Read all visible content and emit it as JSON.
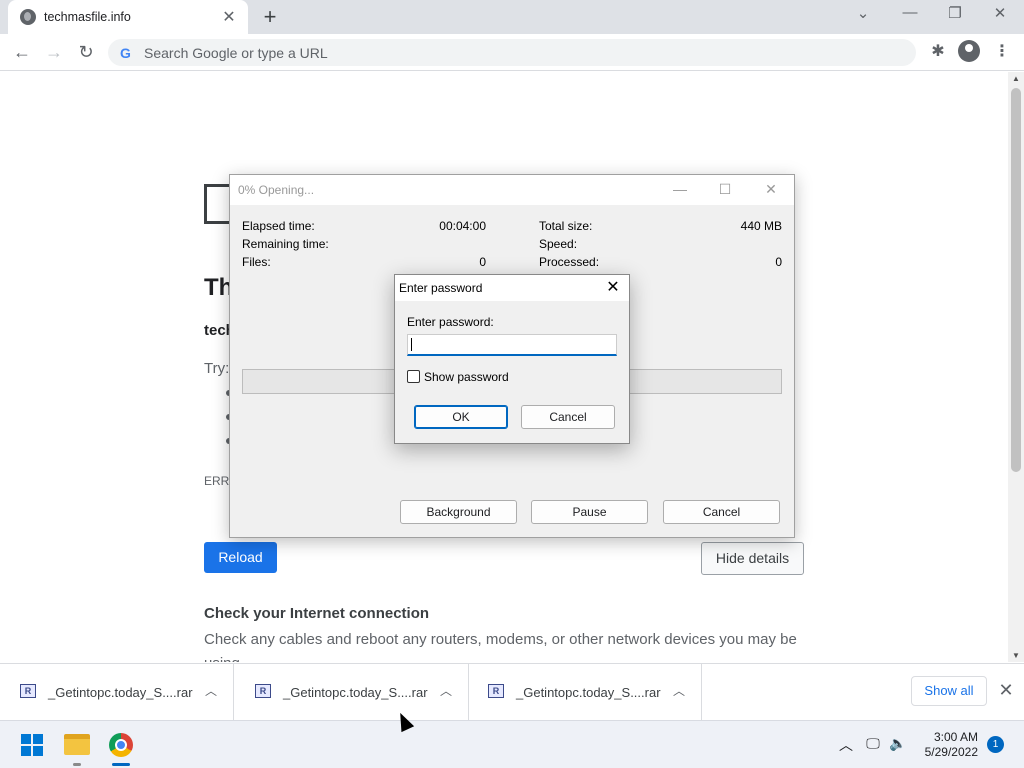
{
  "browser": {
    "tab_title": "techmasfile.info",
    "tab_close": "✕",
    "new_tab": "+",
    "omnibox_placeholder": "Search Google or type a URL",
    "window_controls": {
      "tab_search": "⌄",
      "minimize": "—",
      "restore": "❐",
      "close": "✕"
    },
    "nav": {
      "back": "←",
      "forward": "→",
      "reload": "↻"
    }
  },
  "page": {
    "error_title": "Th",
    "host_text": "tech",
    "try_label": "Try:",
    "error_code": "ERR_",
    "reload_label": "Reload",
    "hide_details_label": "Hide details",
    "check_title": "Check your Internet connection",
    "check_text": "Check any cables and reboot any routers, modems, or other network devices you may be using."
  },
  "winrar": {
    "title": "0% Opening...",
    "stats_left": [
      {
        "label": "Elapsed time:",
        "value": "00:04:00"
      },
      {
        "label": "Remaining time:",
        "value": ""
      },
      {
        "label": "Files:",
        "value": "0"
      }
    ],
    "stats_right": [
      {
        "label": "Total size:",
        "value": "440 MB"
      },
      {
        "label": "Speed:",
        "value": ""
      },
      {
        "label": "Processed:",
        "value": "0"
      }
    ],
    "progress": 0,
    "buttons": {
      "background": "Background",
      "pause": "Pause",
      "cancel": "Cancel"
    }
  },
  "password_dialog": {
    "title": "Enter password",
    "field_label": "Enter password:",
    "field_value": "",
    "show_password_label": "Show password",
    "show_password_checked": false,
    "ok_label": "OK",
    "cancel_label": "Cancel"
  },
  "downloads": {
    "items": [
      {
        "name": "_Getintopc.today_S....rar",
        "icon": "winrar-archive-icon"
      },
      {
        "name": "_Getintopc.today_S....rar",
        "icon": "winrar-archive-icon"
      },
      {
        "name": "_Getintopc.today_S....rar",
        "icon": "winrar-archive-icon"
      }
    ],
    "show_all_label": "Show all"
  },
  "taskbar": {
    "time": "3:00 AM",
    "date": "5/29/2022",
    "notification_count": "1"
  },
  "colors": {
    "accent_blue": "#1a73e8",
    "windows_blue": "#0067c0"
  }
}
